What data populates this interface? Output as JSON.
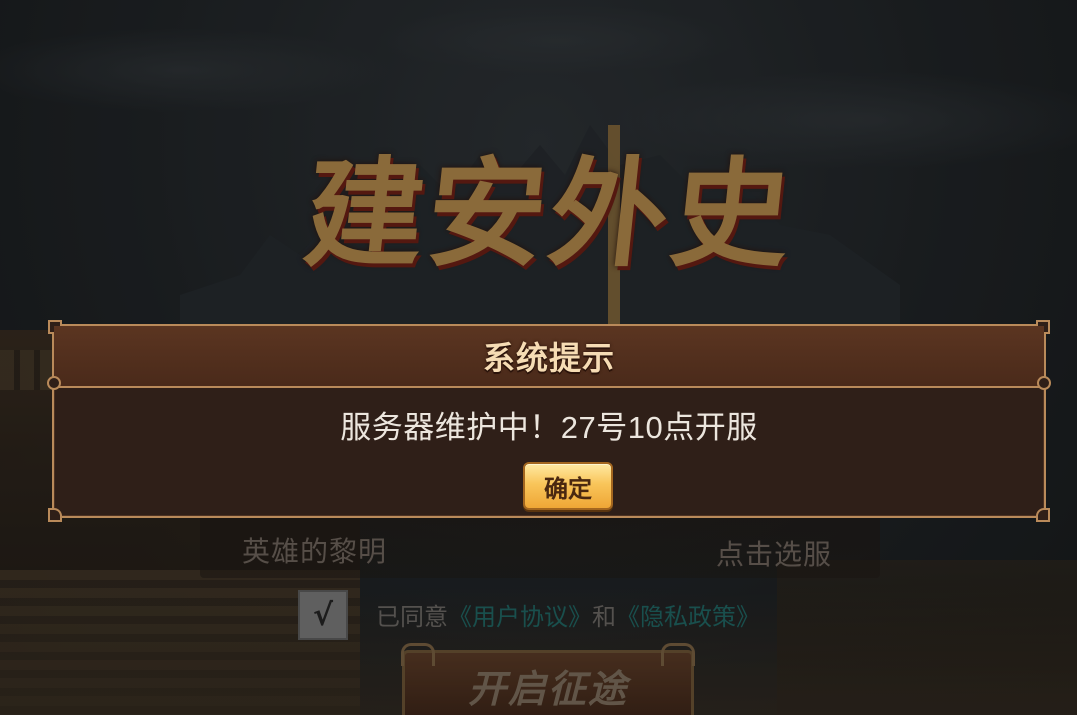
{
  "game": {
    "logo_text": "建安外史"
  },
  "lobby": {
    "server_name": "英雄的黎明",
    "server_select_label": "点击选服",
    "agree_checkbox_mark": "√",
    "agree_prefix": "已同意",
    "user_agreement_link": "《用户协议》",
    "agree_and": "和",
    "privacy_policy_link": "《隐私政策》",
    "start_button_label": "开启征途"
  },
  "dialog": {
    "title": "系统提示",
    "message": "服务器维护中！27号10点开服",
    "confirm_label": "确定"
  },
  "colors": {
    "dialog_border": "#b98a5a",
    "dialog_body": "#2f1f18",
    "dialog_header": "#5b3521",
    "confirm_gold": "#f9c55a",
    "link_teal": "#1e6663"
  }
}
